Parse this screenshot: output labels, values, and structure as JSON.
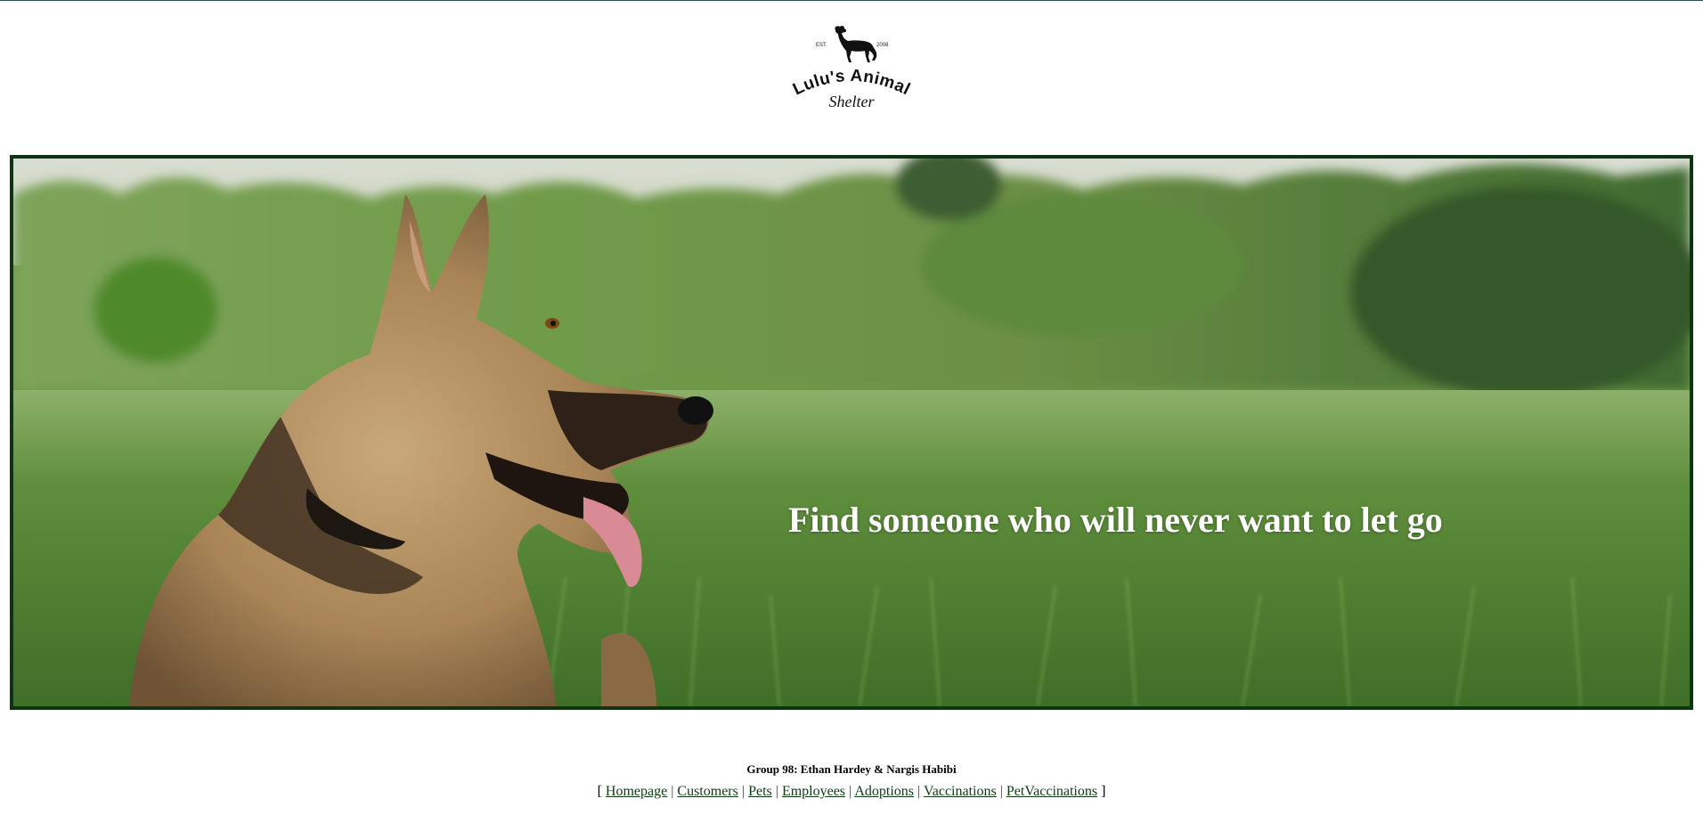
{
  "logo": {
    "est_left": "EST.",
    "est_right": "2008",
    "line1": "Lulu's Animal",
    "line2": "Shelter",
    "icon": "dog-silhouette-icon"
  },
  "hero": {
    "tagline": "Find someone who will never want to let go",
    "image_subject": "German Shepherd dog in a green field"
  },
  "footer": {
    "credits": "Group 98: Ethan Hardey & Nargis Habibi",
    "bracket_open": "[",
    "bracket_close": "]",
    "separator": "|",
    "links": [
      {
        "label": "Homepage"
      },
      {
        "label": "Customers"
      },
      {
        "label": "Pets"
      },
      {
        "label": "Employees"
      },
      {
        "label": "Adoptions"
      },
      {
        "label": "Vaccinations"
      },
      {
        "label": "PetVaccinations"
      }
    ]
  },
  "colors": {
    "hero_border": "#0e3414",
    "link": "#0e3b12",
    "tagline": "#ffffff"
  }
}
